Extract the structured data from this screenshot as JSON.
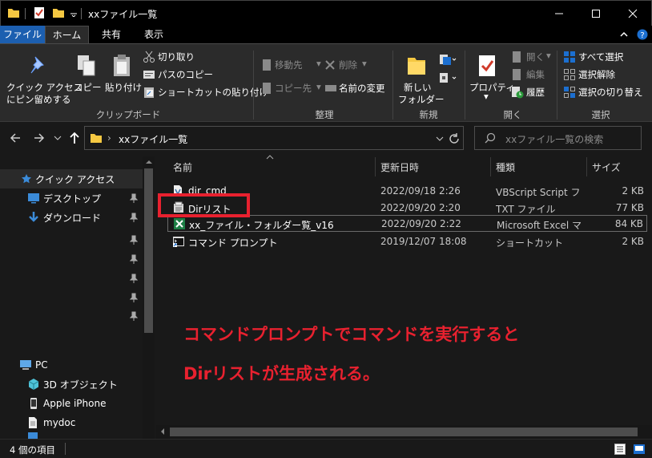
{
  "window": {
    "title": "xxファイル一覧"
  },
  "tabs": {
    "file": "ファイル",
    "home": "ホーム",
    "share": "共有",
    "view": "表示"
  },
  "ribbon": {
    "clipboard": {
      "pin_quick_access": [
        "クイック アクセス",
        "にピン留めする"
      ],
      "copy": "コピー",
      "paste": "貼り付け",
      "cut": "切り取り",
      "copy_path": "パスのコピー",
      "paste_shortcut": "ショートカットの貼り付け",
      "group_label": "クリップボード"
    },
    "organize": {
      "move_to": "移動先",
      "delete": "削除",
      "copy_to": "コピー先",
      "rename": "名前の変更",
      "group_label": "整理"
    },
    "new": {
      "new_folder": [
        "新しい",
        "フォルダー"
      ],
      "group_label": "新規"
    },
    "open": {
      "properties": "プロパティ",
      "open": "開く",
      "edit": "編集",
      "history": "履歴",
      "group_label": "開く"
    },
    "select": {
      "select_all": "すべて選択",
      "select_none": "選択解除",
      "invert_selection": "選択の切り替え",
      "group_label": "選択"
    }
  },
  "address": {
    "path": "xxファイル一覧",
    "search_placeholder": "xxファイル一覧の検索"
  },
  "nav_pane": {
    "quick_access": "クイック アクセス",
    "items": [
      "デスクトップ",
      "ダウンロード"
    ],
    "pc": "PC",
    "pc_items": [
      "3D オブジェクト",
      "Apple iPhone",
      "mydoc"
    ]
  },
  "columns": {
    "name": "名前",
    "date": "更新日時",
    "type": "種類",
    "size": "サイズ"
  },
  "files": [
    {
      "name": "dir_cmd",
      "date": "2022/09/18 2:26",
      "type": "VBScript Script ファ...",
      "size": "2 KB",
      "icon": "vbscript-file-icon"
    },
    {
      "name": "Dirリスト",
      "date": "2022/09/20 2:20",
      "type": "TXT ファイル",
      "size": "77 KB",
      "icon": "text-file-icon"
    },
    {
      "name": "xx_ファイル・フォルダー覧_v16",
      "date": "2022/09/20 2:22",
      "type": "Microsoft Excel マ...",
      "size": "84 KB",
      "icon": "excel-file-icon"
    },
    {
      "name": "コマンド プロンプト",
      "date": "2019/12/07 18:08",
      "type": "ショートカット",
      "size": "2 KB",
      "icon": "cmd-shortcut-icon"
    }
  ],
  "annotation": {
    "line1": "コマンドプロンプトでコマンドを実行すると",
    "line2": "Dirリストが生成される。",
    "color": "#e8212f"
  },
  "status": {
    "item_count": "4 個の項目"
  },
  "colors": {
    "accent": "#1c5fb0",
    "background": "#191919",
    "ribbon": "#2b2b2b",
    "highlight_box": "#e8212f"
  }
}
